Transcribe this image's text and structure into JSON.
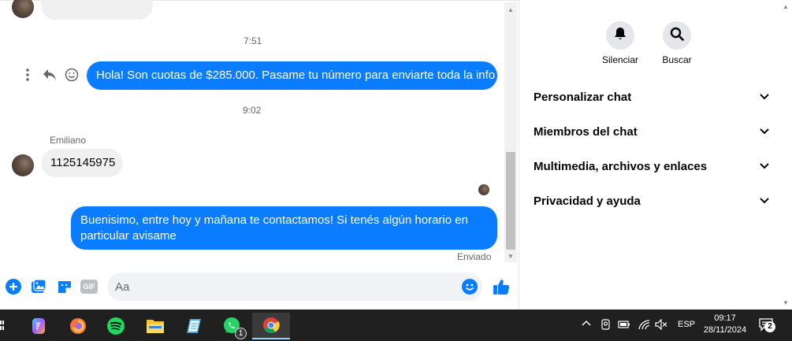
{
  "conversation": {
    "time_1": "7:51",
    "outgoing_1": "Hola! Son cuotas de $285.000. Pasame tu número para enviarte toda la info",
    "time_2": "9:02",
    "sender_name": "Emiliano",
    "incoming_1": "1125145975",
    "outgoing_2_line1": "Buenisimo, entre hoy y mañana te contactamos! Si tenés algún horario en",
    "outgoing_2_line2": "particular avisame",
    "status": "Enviado"
  },
  "composer": {
    "placeholder": "Aa",
    "gif_label": "GIF"
  },
  "panel": {
    "mute_label": "Silenciar",
    "search_label": "Buscar",
    "sections": [
      "Personalizar chat",
      "Miembros del chat",
      "Multimedia, archivos y enlaces",
      "Privacidad y ayuda"
    ]
  },
  "taskbar": {
    "whatsapp_badge": "1",
    "language": "ESP",
    "time": "09:17",
    "date": "28/11/2024",
    "notifications": "2"
  },
  "colors": {
    "accent": "#0a7cff",
    "bubble_in": "#f0f0f0",
    "taskbar": "#202020"
  }
}
